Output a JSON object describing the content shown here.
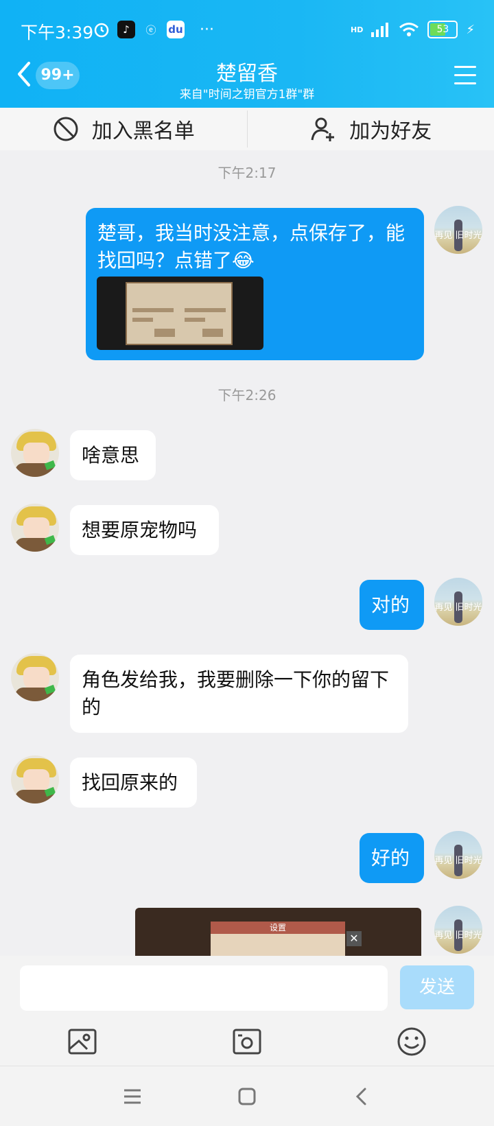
{
  "status_bar": {
    "time": "下午3:39",
    "battery": "53",
    "dots": "···",
    "signal_label": "HD"
  },
  "header": {
    "unread_badge": "99+",
    "title": "楚留香",
    "subtitle": "来自\"时间之钥官方1群\"群"
  },
  "actions": {
    "block_label": "加入黑名单",
    "add_friend_label": "加为好友"
  },
  "messages": [
    {
      "type": "timestamp",
      "text": "下午2:17"
    },
    {
      "type": "self",
      "text": "楚哥，我当时没注意，点保存了，能找回吗？点错了😂",
      "has_image": true
    },
    {
      "type": "timestamp",
      "text": "下午2:26"
    },
    {
      "type": "other",
      "text": "啥意思"
    },
    {
      "type": "other",
      "text": "想要原宠物吗"
    },
    {
      "type": "self",
      "text": "对的"
    },
    {
      "type": "other",
      "text": "角色发给我，我要删除一下你的留下的"
    },
    {
      "type": "other",
      "text": "找回原来的"
    },
    {
      "type": "self",
      "text": "好的"
    },
    {
      "type": "self-image",
      "image_title": "设置"
    }
  ],
  "avatar_self_text": "再见 旧时光",
  "input": {
    "placeholder": "",
    "send_label": "发送"
  },
  "icons": {
    "back": "chevron-left-icon",
    "menu": "hamburger-menu-icon",
    "block": "block-icon",
    "add_friend": "add-user-icon",
    "image": "image-icon",
    "camera": "camera-icon",
    "emoji": "emoji-icon"
  }
}
